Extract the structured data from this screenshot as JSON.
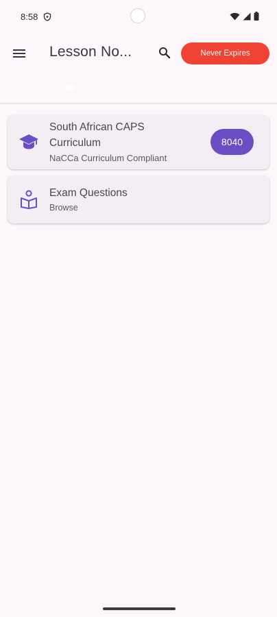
{
  "status_bar": {
    "time": "8:58",
    "icons": [
      "shield-icon",
      "wifi-icon",
      "signal-icon",
      "battery-icon"
    ]
  },
  "app_bar": {
    "title": "Lesson No...",
    "menu_icon": "menu-icon",
    "search_icon": "search-icon",
    "action_label": "Never Expires",
    "action_color": "#f04334"
  },
  "cards": [
    {
      "title": "South African CAPS Curriculum",
      "subtitle": "NaCCa Curriculum Compliant",
      "badge": "8040",
      "icon": "graduation-cap-icon"
    },
    {
      "title": "Exam Questions",
      "subtitle": "Browse",
      "icon": "reading-person-icon"
    }
  ],
  "colors": {
    "background": "#fdf7fc",
    "card": "#f3eef4",
    "accent": "#6a4fc4",
    "danger": "#f04334"
  }
}
